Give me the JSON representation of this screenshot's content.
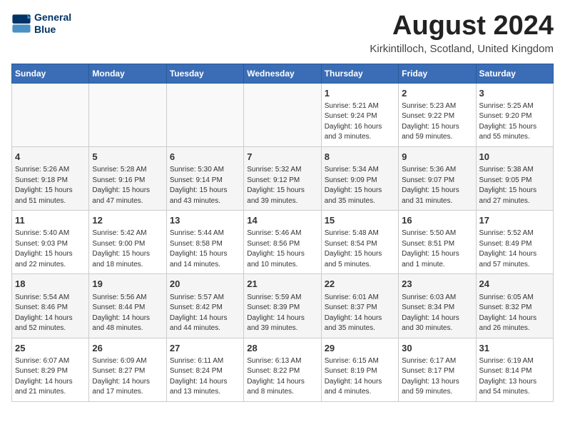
{
  "logo": {
    "line1": "General",
    "line2": "Blue"
  },
  "title": "August 2024",
  "location": "Kirkintilloch, Scotland, United Kingdom",
  "headers": [
    "Sunday",
    "Monday",
    "Tuesday",
    "Wednesday",
    "Thursday",
    "Friday",
    "Saturday"
  ],
  "weeks": [
    [
      {
        "day": "",
        "info": ""
      },
      {
        "day": "",
        "info": ""
      },
      {
        "day": "",
        "info": ""
      },
      {
        "day": "",
        "info": ""
      },
      {
        "day": "1",
        "info": "Sunrise: 5:21 AM\nSunset: 9:24 PM\nDaylight: 16 hours\nand 3 minutes."
      },
      {
        "day": "2",
        "info": "Sunrise: 5:23 AM\nSunset: 9:22 PM\nDaylight: 15 hours\nand 59 minutes."
      },
      {
        "day": "3",
        "info": "Sunrise: 5:25 AM\nSunset: 9:20 PM\nDaylight: 15 hours\nand 55 minutes."
      }
    ],
    [
      {
        "day": "4",
        "info": "Sunrise: 5:26 AM\nSunset: 9:18 PM\nDaylight: 15 hours\nand 51 minutes."
      },
      {
        "day": "5",
        "info": "Sunrise: 5:28 AM\nSunset: 9:16 PM\nDaylight: 15 hours\nand 47 minutes."
      },
      {
        "day": "6",
        "info": "Sunrise: 5:30 AM\nSunset: 9:14 PM\nDaylight: 15 hours\nand 43 minutes."
      },
      {
        "day": "7",
        "info": "Sunrise: 5:32 AM\nSunset: 9:12 PM\nDaylight: 15 hours\nand 39 minutes."
      },
      {
        "day": "8",
        "info": "Sunrise: 5:34 AM\nSunset: 9:09 PM\nDaylight: 15 hours\nand 35 minutes."
      },
      {
        "day": "9",
        "info": "Sunrise: 5:36 AM\nSunset: 9:07 PM\nDaylight: 15 hours\nand 31 minutes."
      },
      {
        "day": "10",
        "info": "Sunrise: 5:38 AM\nSunset: 9:05 PM\nDaylight: 15 hours\nand 27 minutes."
      }
    ],
    [
      {
        "day": "11",
        "info": "Sunrise: 5:40 AM\nSunset: 9:03 PM\nDaylight: 15 hours\nand 22 minutes."
      },
      {
        "day": "12",
        "info": "Sunrise: 5:42 AM\nSunset: 9:00 PM\nDaylight: 15 hours\nand 18 minutes."
      },
      {
        "day": "13",
        "info": "Sunrise: 5:44 AM\nSunset: 8:58 PM\nDaylight: 15 hours\nand 14 minutes."
      },
      {
        "day": "14",
        "info": "Sunrise: 5:46 AM\nSunset: 8:56 PM\nDaylight: 15 hours\nand 10 minutes."
      },
      {
        "day": "15",
        "info": "Sunrise: 5:48 AM\nSunset: 8:54 PM\nDaylight: 15 hours\nand 5 minutes."
      },
      {
        "day": "16",
        "info": "Sunrise: 5:50 AM\nSunset: 8:51 PM\nDaylight: 15 hours\nand 1 minute."
      },
      {
        "day": "17",
        "info": "Sunrise: 5:52 AM\nSunset: 8:49 PM\nDaylight: 14 hours\nand 57 minutes."
      }
    ],
    [
      {
        "day": "18",
        "info": "Sunrise: 5:54 AM\nSunset: 8:46 PM\nDaylight: 14 hours\nand 52 minutes."
      },
      {
        "day": "19",
        "info": "Sunrise: 5:56 AM\nSunset: 8:44 PM\nDaylight: 14 hours\nand 48 minutes."
      },
      {
        "day": "20",
        "info": "Sunrise: 5:57 AM\nSunset: 8:42 PM\nDaylight: 14 hours\nand 44 minutes."
      },
      {
        "day": "21",
        "info": "Sunrise: 5:59 AM\nSunset: 8:39 PM\nDaylight: 14 hours\nand 39 minutes."
      },
      {
        "day": "22",
        "info": "Sunrise: 6:01 AM\nSunset: 8:37 PM\nDaylight: 14 hours\nand 35 minutes."
      },
      {
        "day": "23",
        "info": "Sunrise: 6:03 AM\nSunset: 8:34 PM\nDaylight: 14 hours\nand 30 minutes."
      },
      {
        "day": "24",
        "info": "Sunrise: 6:05 AM\nSunset: 8:32 PM\nDaylight: 14 hours\nand 26 minutes."
      }
    ],
    [
      {
        "day": "25",
        "info": "Sunrise: 6:07 AM\nSunset: 8:29 PM\nDaylight: 14 hours\nand 21 minutes."
      },
      {
        "day": "26",
        "info": "Sunrise: 6:09 AM\nSunset: 8:27 PM\nDaylight: 14 hours\nand 17 minutes."
      },
      {
        "day": "27",
        "info": "Sunrise: 6:11 AM\nSunset: 8:24 PM\nDaylight: 14 hours\nand 13 minutes."
      },
      {
        "day": "28",
        "info": "Sunrise: 6:13 AM\nSunset: 8:22 PM\nDaylight: 14 hours\nand 8 minutes."
      },
      {
        "day": "29",
        "info": "Sunrise: 6:15 AM\nSunset: 8:19 PM\nDaylight: 14 hours\nand 4 minutes."
      },
      {
        "day": "30",
        "info": "Sunrise: 6:17 AM\nSunset: 8:17 PM\nDaylight: 13 hours\nand 59 minutes."
      },
      {
        "day": "31",
        "info": "Sunrise: 6:19 AM\nSunset: 8:14 PM\nDaylight: 13 hours\nand 54 minutes."
      }
    ]
  ]
}
